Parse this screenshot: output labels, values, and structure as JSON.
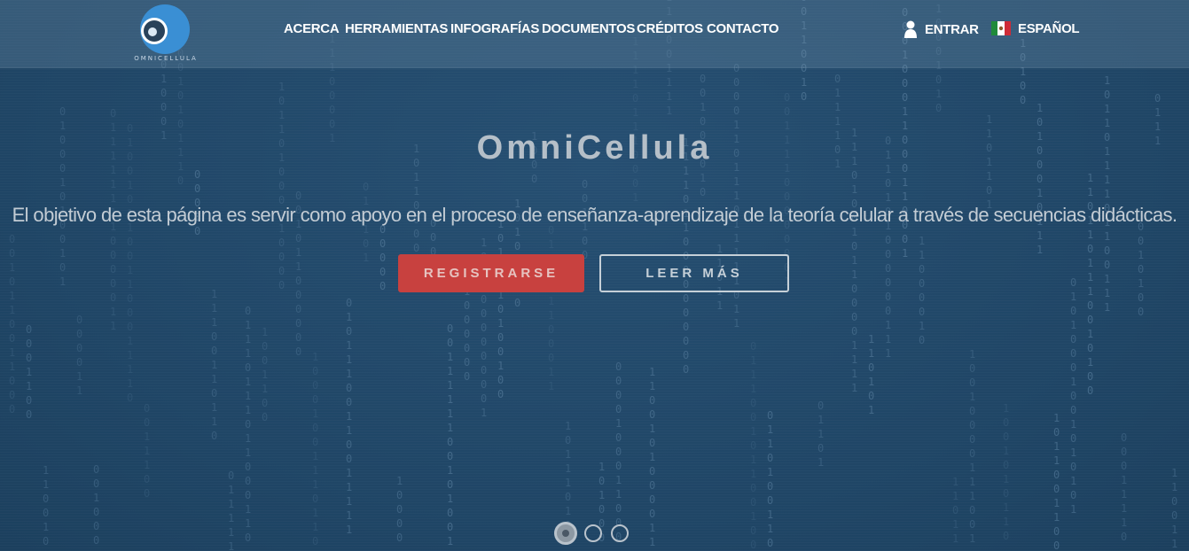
{
  "brand": {
    "logo_text": "OMNICELLULA",
    "accent": "#3a8fd4"
  },
  "nav": {
    "items": [
      {
        "label": "ACERCA"
      },
      {
        "label": "HERRAMIENTAS"
      },
      {
        "label": "INFOGRAFÍAS"
      },
      {
        "label": "DOCUMENTOS"
      },
      {
        "label": "CRÉDITOS"
      },
      {
        "label": "CONTACTO"
      }
    ],
    "login_label": "ENTRAR",
    "language_label": "ESPAÑOL",
    "login_icon": "user-icon",
    "language_icon": "mexico-flag-icon"
  },
  "hero": {
    "title": "OmniCellula",
    "subtitle": "El objetivo de esta página es servir como apoyo en el proceso de enseñanza-aprendizaje de la teoría celular a través de secuencias didácticas.",
    "register_label": "REGISTRARSE",
    "read_more_label": "LEER MÁS",
    "register_color": "#c8413f"
  },
  "carousel": {
    "slide_count": 3,
    "active_index": 0
  }
}
